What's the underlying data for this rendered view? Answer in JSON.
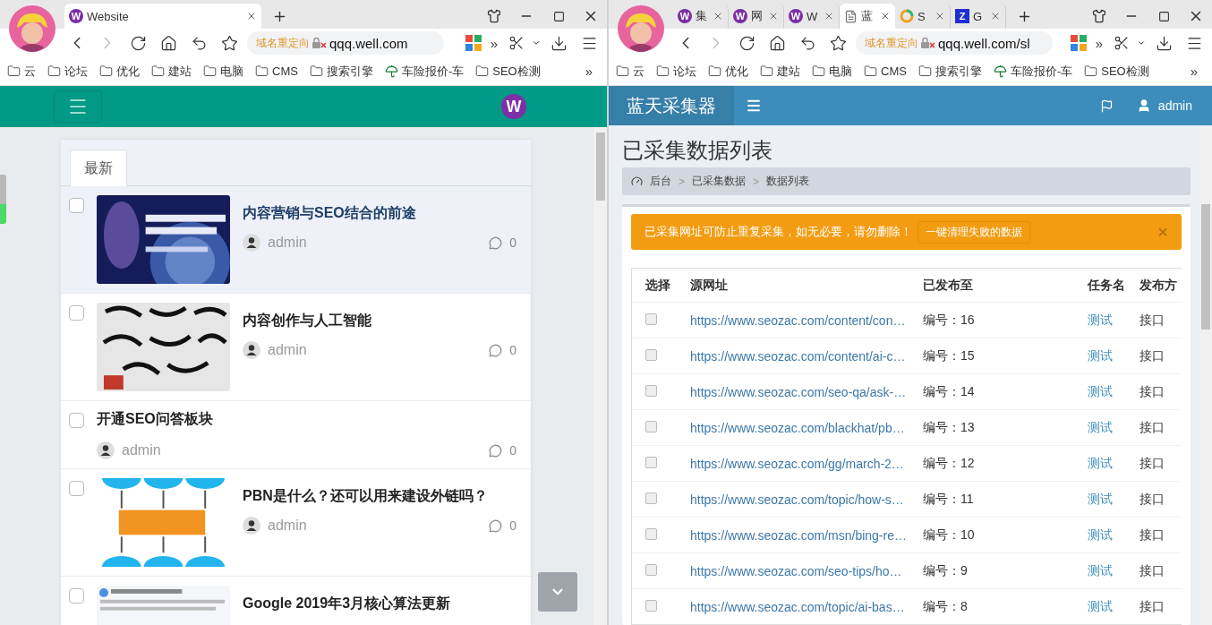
{
  "left_window": {
    "tabs": [
      {
        "label": "Website",
        "kind": "circle",
        "favicon_text": "W",
        "selected": true
      }
    ],
    "address": {
      "notice": "域名重定向",
      "url": "qqq.well.com"
    },
    "toolbar_more": "»",
    "bookmarks": [
      {
        "label": "云",
        "kind": "folder"
      },
      {
        "label": "论坛",
        "kind": "folder"
      },
      {
        "label": "优化",
        "kind": "folder"
      },
      {
        "label": "建站",
        "kind": "folder"
      },
      {
        "label": "电脑",
        "kind": "folder"
      },
      {
        "label": "CMS",
        "kind": "folder"
      },
      {
        "label": "搜索引擎",
        "kind": "folder"
      },
      {
        "label": "车险报价-车",
        "kind": "umbrella"
      },
      {
        "label": "SEO检测",
        "kind": "folder"
      }
    ],
    "bookmarks_more": "»",
    "site": {
      "logo_text": "W",
      "tabs": [
        {
          "label": "最新",
          "selected": true
        }
      ],
      "posts": [
        {
          "title": "内容营销与SEO结合的前途",
          "author": "admin",
          "comments": "0",
          "highlighted": true,
          "checked": false
        },
        {
          "title": "内容创作与人工智能",
          "author": "admin",
          "comments": "0",
          "highlighted": false,
          "checked": false
        },
        {
          "title": "开通SEO问答板块",
          "author": "admin",
          "comments": "0",
          "highlighted": false,
          "checked": false
        },
        {
          "title": "PBN是什么？还可以用来建设外链吗？",
          "author": "admin",
          "comments": "0",
          "highlighted": false,
          "checked": false
        },
        {
          "title": "Google 2019年3月核心算法更新",
          "highlighted": false,
          "checked": false
        }
      ]
    }
  },
  "right_window": {
    "tabs": [
      {
        "label": "集",
        "kind": "circle",
        "favicon_text": "W",
        "selected": false
      },
      {
        "label": "网",
        "kind": "circle",
        "favicon_text": "W",
        "selected": false
      },
      {
        "label": "W",
        "kind": "circle",
        "favicon_text": "W",
        "selected": false
      },
      {
        "label": "蓝",
        "kind": "page",
        "selected": true
      },
      {
        "label": "S",
        "kind": "ring",
        "selected": false
      },
      {
        "label": "G",
        "kind": "square",
        "favicon_text": "Z",
        "selected": false
      }
    ],
    "address": {
      "notice": "域名重定向",
      "url": "qqq.well.com/sl"
    },
    "toolbar_more": "»",
    "bookmarks": [
      {
        "label": "云",
        "kind": "folder"
      },
      {
        "label": "论坛",
        "kind": "folder"
      },
      {
        "label": "优化",
        "kind": "folder"
      },
      {
        "label": "建站",
        "kind": "folder"
      },
      {
        "label": "电脑",
        "kind": "folder"
      },
      {
        "label": "CMS",
        "kind": "folder"
      },
      {
        "label": "搜索引擎",
        "kind": "folder"
      },
      {
        "label": "车险报价-车",
        "kind": "umbrella"
      },
      {
        "label": "SEO检测",
        "kind": "folder"
      }
    ],
    "bookmarks_more": "»",
    "app": {
      "brand": "蓝天采集器",
      "user": "admin",
      "title": "已采集数据列表",
      "breadcrumb": [
        {
          "label": "后台"
        },
        {
          "label": "已采集数据",
          "separator": ">"
        },
        {
          "label": "数据列表",
          "separator": ">"
        }
      ],
      "alert": {
        "message": "已采集网址可防止重复采集，如无必要，请勿删除！",
        "button": "一键清理失败的数据",
        "close": "×"
      },
      "columns": [
        "选择",
        "源网址",
        "已发布至",
        "任务名",
        "发布方"
      ],
      "rows": [
        {
          "checked": false,
          "url": "https://www.seozac.com/content/con…",
          "published": "编号：16",
          "task": "测试",
          "method": "接口"
        },
        {
          "checked": false,
          "url": "https://www.seozac.com/content/ai-c…",
          "published": "编号：15",
          "task": "测试",
          "method": "接口"
        },
        {
          "checked": false,
          "url": "https://www.seozac.com/seo-qa/ask-…",
          "published": "编号：14",
          "task": "测试",
          "method": "接口"
        },
        {
          "checked": false,
          "url": "https://www.seozac.com/blackhat/pb…",
          "published": "编号：13",
          "task": "测试",
          "method": "接口"
        },
        {
          "checked": false,
          "url": "https://www.seozac.com/gg/march-2…",
          "published": "编号：12",
          "task": "测试",
          "method": "接口"
        },
        {
          "checked": false,
          "url": "https://www.seozac.com/topic/how-s…",
          "published": "编号：11",
          "task": "测试",
          "method": "接口"
        },
        {
          "checked": false,
          "url": "https://www.seozac.com/msn/bing-re…",
          "published": "编号：10",
          "task": "测试",
          "method": "接口"
        },
        {
          "checked": false,
          "url": "https://www.seozac.com/seo-tips/ho…",
          "published": "编号：9",
          "task": "测试",
          "method": "接口"
        },
        {
          "checked": false,
          "url": "https://www.seozac.com/topic/ai-bas…",
          "published": "编号：8",
          "task": "测试",
          "method": "接口"
        }
      ]
    }
  }
}
